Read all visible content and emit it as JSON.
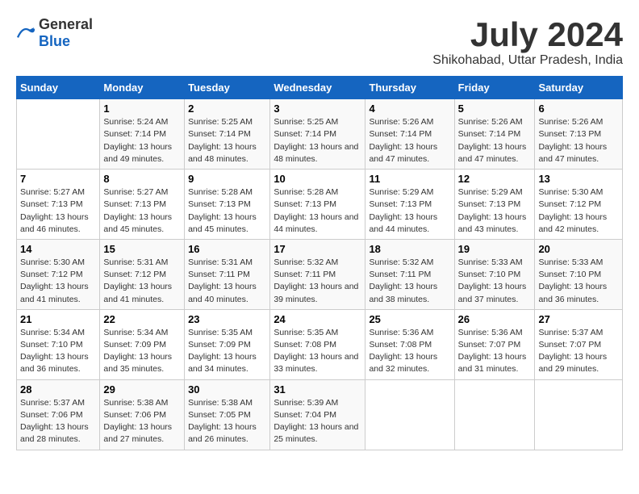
{
  "logo": {
    "general": "General",
    "blue": "Blue"
  },
  "title": "July 2024",
  "subtitle": "Shikohabad, Uttar Pradesh, India",
  "headers": [
    "Sunday",
    "Monday",
    "Tuesday",
    "Wednesday",
    "Thursday",
    "Friday",
    "Saturday"
  ],
  "weeks": [
    [
      {
        "day": "",
        "sunrise": "",
        "sunset": "",
        "daylight": ""
      },
      {
        "day": "1",
        "sunrise": "Sunrise: 5:24 AM",
        "sunset": "Sunset: 7:14 PM",
        "daylight": "Daylight: 13 hours and 49 minutes."
      },
      {
        "day": "2",
        "sunrise": "Sunrise: 5:25 AM",
        "sunset": "Sunset: 7:14 PM",
        "daylight": "Daylight: 13 hours and 48 minutes."
      },
      {
        "day": "3",
        "sunrise": "Sunrise: 5:25 AM",
        "sunset": "Sunset: 7:14 PM",
        "daylight": "Daylight: 13 hours and 48 minutes."
      },
      {
        "day": "4",
        "sunrise": "Sunrise: 5:26 AM",
        "sunset": "Sunset: 7:14 PM",
        "daylight": "Daylight: 13 hours and 47 minutes."
      },
      {
        "day": "5",
        "sunrise": "Sunrise: 5:26 AM",
        "sunset": "Sunset: 7:14 PM",
        "daylight": "Daylight: 13 hours and 47 minutes."
      },
      {
        "day": "6",
        "sunrise": "Sunrise: 5:26 AM",
        "sunset": "Sunset: 7:13 PM",
        "daylight": "Daylight: 13 hours and 47 minutes."
      }
    ],
    [
      {
        "day": "7",
        "sunrise": "Sunrise: 5:27 AM",
        "sunset": "Sunset: 7:13 PM",
        "daylight": "Daylight: 13 hours and 46 minutes."
      },
      {
        "day": "8",
        "sunrise": "Sunrise: 5:27 AM",
        "sunset": "Sunset: 7:13 PM",
        "daylight": "Daylight: 13 hours and 45 minutes."
      },
      {
        "day": "9",
        "sunrise": "Sunrise: 5:28 AM",
        "sunset": "Sunset: 7:13 PM",
        "daylight": "Daylight: 13 hours and 45 minutes."
      },
      {
        "day": "10",
        "sunrise": "Sunrise: 5:28 AM",
        "sunset": "Sunset: 7:13 PM",
        "daylight": "Daylight: 13 hours and 44 minutes."
      },
      {
        "day": "11",
        "sunrise": "Sunrise: 5:29 AM",
        "sunset": "Sunset: 7:13 PM",
        "daylight": "Daylight: 13 hours and 44 minutes."
      },
      {
        "day": "12",
        "sunrise": "Sunrise: 5:29 AM",
        "sunset": "Sunset: 7:13 PM",
        "daylight": "Daylight: 13 hours and 43 minutes."
      },
      {
        "day": "13",
        "sunrise": "Sunrise: 5:30 AM",
        "sunset": "Sunset: 7:12 PM",
        "daylight": "Daylight: 13 hours and 42 minutes."
      }
    ],
    [
      {
        "day": "14",
        "sunrise": "Sunrise: 5:30 AM",
        "sunset": "Sunset: 7:12 PM",
        "daylight": "Daylight: 13 hours and 41 minutes."
      },
      {
        "day": "15",
        "sunrise": "Sunrise: 5:31 AM",
        "sunset": "Sunset: 7:12 PM",
        "daylight": "Daylight: 13 hours and 41 minutes."
      },
      {
        "day": "16",
        "sunrise": "Sunrise: 5:31 AM",
        "sunset": "Sunset: 7:11 PM",
        "daylight": "Daylight: 13 hours and 40 minutes."
      },
      {
        "day": "17",
        "sunrise": "Sunrise: 5:32 AM",
        "sunset": "Sunset: 7:11 PM",
        "daylight": "Daylight: 13 hours and 39 minutes."
      },
      {
        "day": "18",
        "sunrise": "Sunrise: 5:32 AM",
        "sunset": "Sunset: 7:11 PM",
        "daylight": "Daylight: 13 hours and 38 minutes."
      },
      {
        "day": "19",
        "sunrise": "Sunrise: 5:33 AM",
        "sunset": "Sunset: 7:10 PM",
        "daylight": "Daylight: 13 hours and 37 minutes."
      },
      {
        "day": "20",
        "sunrise": "Sunrise: 5:33 AM",
        "sunset": "Sunset: 7:10 PM",
        "daylight": "Daylight: 13 hours and 36 minutes."
      }
    ],
    [
      {
        "day": "21",
        "sunrise": "Sunrise: 5:34 AM",
        "sunset": "Sunset: 7:10 PM",
        "daylight": "Daylight: 13 hours and 36 minutes."
      },
      {
        "day": "22",
        "sunrise": "Sunrise: 5:34 AM",
        "sunset": "Sunset: 7:09 PM",
        "daylight": "Daylight: 13 hours and 35 minutes."
      },
      {
        "day": "23",
        "sunrise": "Sunrise: 5:35 AM",
        "sunset": "Sunset: 7:09 PM",
        "daylight": "Daylight: 13 hours and 34 minutes."
      },
      {
        "day": "24",
        "sunrise": "Sunrise: 5:35 AM",
        "sunset": "Sunset: 7:08 PM",
        "daylight": "Daylight: 13 hours and 33 minutes."
      },
      {
        "day": "25",
        "sunrise": "Sunrise: 5:36 AM",
        "sunset": "Sunset: 7:08 PM",
        "daylight": "Daylight: 13 hours and 32 minutes."
      },
      {
        "day": "26",
        "sunrise": "Sunrise: 5:36 AM",
        "sunset": "Sunset: 7:07 PM",
        "daylight": "Daylight: 13 hours and 31 minutes."
      },
      {
        "day": "27",
        "sunrise": "Sunrise: 5:37 AM",
        "sunset": "Sunset: 7:07 PM",
        "daylight": "Daylight: 13 hours and 29 minutes."
      }
    ],
    [
      {
        "day": "28",
        "sunrise": "Sunrise: 5:37 AM",
        "sunset": "Sunset: 7:06 PM",
        "daylight": "Daylight: 13 hours and 28 minutes."
      },
      {
        "day": "29",
        "sunrise": "Sunrise: 5:38 AM",
        "sunset": "Sunset: 7:06 PM",
        "daylight": "Daylight: 13 hours and 27 minutes."
      },
      {
        "day": "30",
        "sunrise": "Sunrise: 5:38 AM",
        "sunset": "Sunset: 7:05 PM",
        "daylight": "Daylight: 13 hours and 26 minutes."
      },
      {
        "day": "31",
        "sunrise": "Sunrise: 5:39 AM",
        "sunset": "Sunset: 7:04 PM",
        "daylight": "Daylight: 13 hours and 25 minutes."
      },
      {
        "day": "",
        "sunrise": "",
        "sunset": "",
        "daylight": ""
      },
      {
        "day": "",
        "sunrise": "",
        "sunset": "",
        "daylight": ""
      },
      {
        "day": "",
        "sunrise": "",
        "sunset": "",
        "daylight": ""
      }
    ]
  ]
}
